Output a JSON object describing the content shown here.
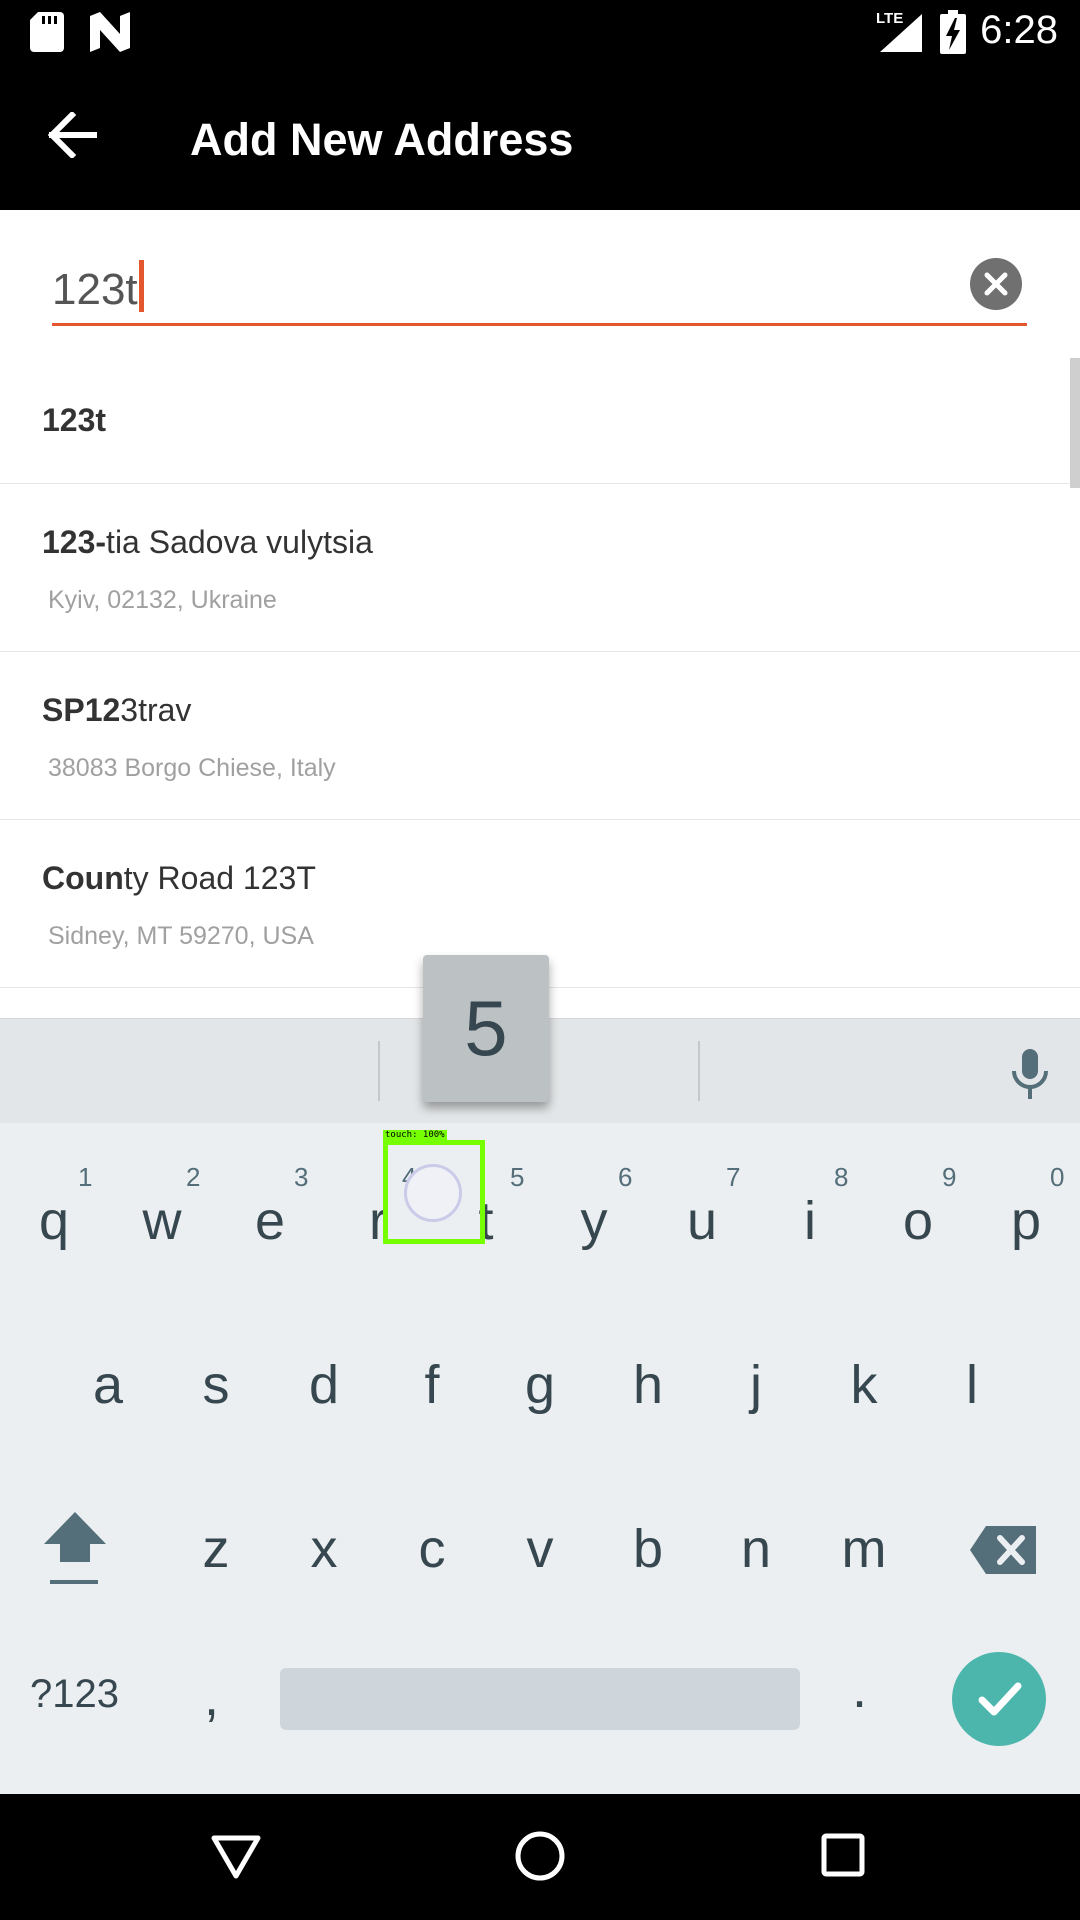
{
  "status_bar": {
    "time": "6:28",
    "network": "LTE",
    "icons": [
      "sd-card-icon",
      "n-logo-icon",
      "signal-icon",
      "battery-charging-icon"
    ]
  },
  "app_bar": {
    "back_icon": "arrow-left-icon",
    "title": "Add New Address"
  },
  "search": {
    "value": "123t",
    "clear_icon": "clear-circle-icon",
    "accent_color": "#e4572e"
  },
  "results": [
    {
      "primary_bold": "123t",
      "primary_rest": "",
      "secondary": ""
    },
    {
      "primary_bold": "123-",
      "primary_rest": "tia Sadova vulytsia",
      "secondary": "Kyiv, 02132, Ukraine"
    },
    {
      "primary_bold": "SP12",
      "primary_rest": "3trav",
      "secondary": "38083 Borgo Chiese, Italy"
    },
    {
      "primary_bold": "Coun",
      "primary_rest": "ty Road 123T",
      "secondary": "Sidney, MT 59270, USA"
    }
  ],
  "keyboard": {
    "suggestion_icon": "microphone-icon",
    "key_preview": "5",
    "row1": [
      {
        "letter": "q",
        "num": "1"
      },
      {
        "letter": "w",
        "num": "2"
      },
      {
        "letter": "e",
        "num": "3"
      },
      {
        "letter": "r",
        "num": "4"
      },
      {
        "letter": "t",
        "num": "5"
      },
      {
        "letter": "y",
        "num": "6"
      },
      {
        "letter": "u",
        "num": "7"
      },
      {
        "letter": "i",
        "num": "8"
      },
      {
        "letter": "o",
        "num": "9"
      },
      {
        "letter": "p",
        "num": "0"
      }
    ],
    "row2": [
      "a",
      "s",
      "d",
      "f",
      "g",
      "h",
      "j",
      "k",
      "l"
    ],
    "row3": [
      "z",
      "x",
      "c",
      "v",
      "b",
      "n",
      "m"
    ],
    "symbols_label": "?123",
    "comma": ",",
    "period": ".",
    "shift_icon": "shift-arrow-icon",
    "backspace_icon": "backspace-icon",
    "enter_icon": "checkmark-icon",
    "enter_color": "#4db6ac"
  },
  "touch_overlay": {
    "label": "touch: 100%"
  },
  "nav_bar": {
    "icons": [
      "back-triangle-icon",
      "home-circle-icon",
      "recents-square-icon"
    ]
  }
}
